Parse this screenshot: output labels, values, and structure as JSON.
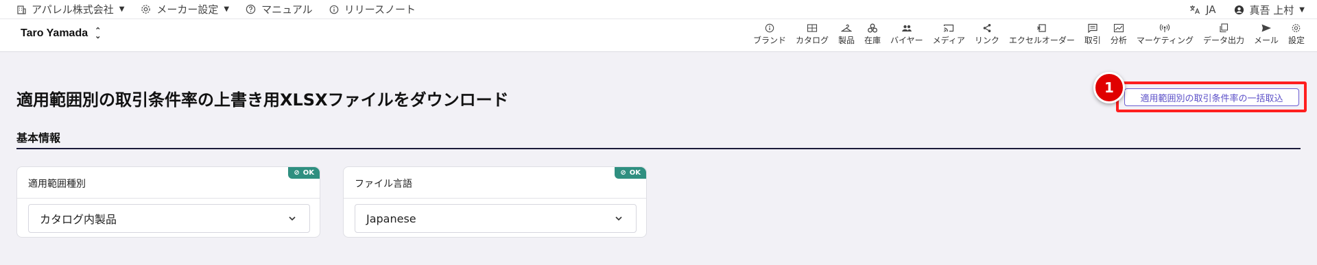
{
  "topbar": {
    "company": "アパレル株式会社",
    "maker_settings": "メーカー設定",
    "manual": "マニュアル",
    "release_notes": "リリースノート",
    "language": "JA",
    "user": "真吾 上村"
  },
  "navbar": {
    "account_name": "Taro Yamada",
    "items": [
      {
        "label": "ブランド",
        "icon": "info-circle-icon"
      },
      {
        "label": "カタログ",
        "icon": "catalog-icon"
      },
      {
        "label": "製品",
        "icon": "hanger-icon"
      },
      {
        "label": "在庫",
        "icon": "boxes-icon"
      },
      {
        "label": "バイヤー",
        "icon": "people-icon"
      },
      {
        "label": "メディア",
        "icon": "cast-icon"
      },
      {
        "label": "リンク",
        "icon": "share-icon"
      },
      {
        "label": "エクセルオーダー",
        "icon": "excel-order-icon"
      },
      {
        "label": "取引",
        "icon": "chat-icon"
      },
      {
        "label": "分析",
        "icon": "chart-icon"
      },
      {
        "label": "マーケティング",
        "icon": "broadcast-icon"
      },
      {
        "label": "データ出力",
        "icon": "copy-icon"
      },
      {
        "label": "メール",
        "icon": "send-icon"
      },
      {
        "label": "設定",
        "icon": "gear-icon"
      }
    ]
  },
  "page": {
    "title": "適用範囲別の取引条件率の上書き用XLSXファイルをダウンロード",
    "import_button": "適用範囲別の取引条件率の一括取込",
    "step_number": "1",
    "section_title": "基本情報"
  },
  "cards": [
    {
      "label": "適用範囲種別",
      "badge": "OK",
      "value": "カタログ内製品"
    },
    {
      "label": "ファイル言語",
      "badge": "OK",
      "value": "Japanese"
    }
  ],
  "colors": {
    "accent": "#5b4fc8",
    "highlight": "#ff1f1f",
    "ok_badge": "#2f8f80",
    "background": "#f2f1f6"
  }
}
